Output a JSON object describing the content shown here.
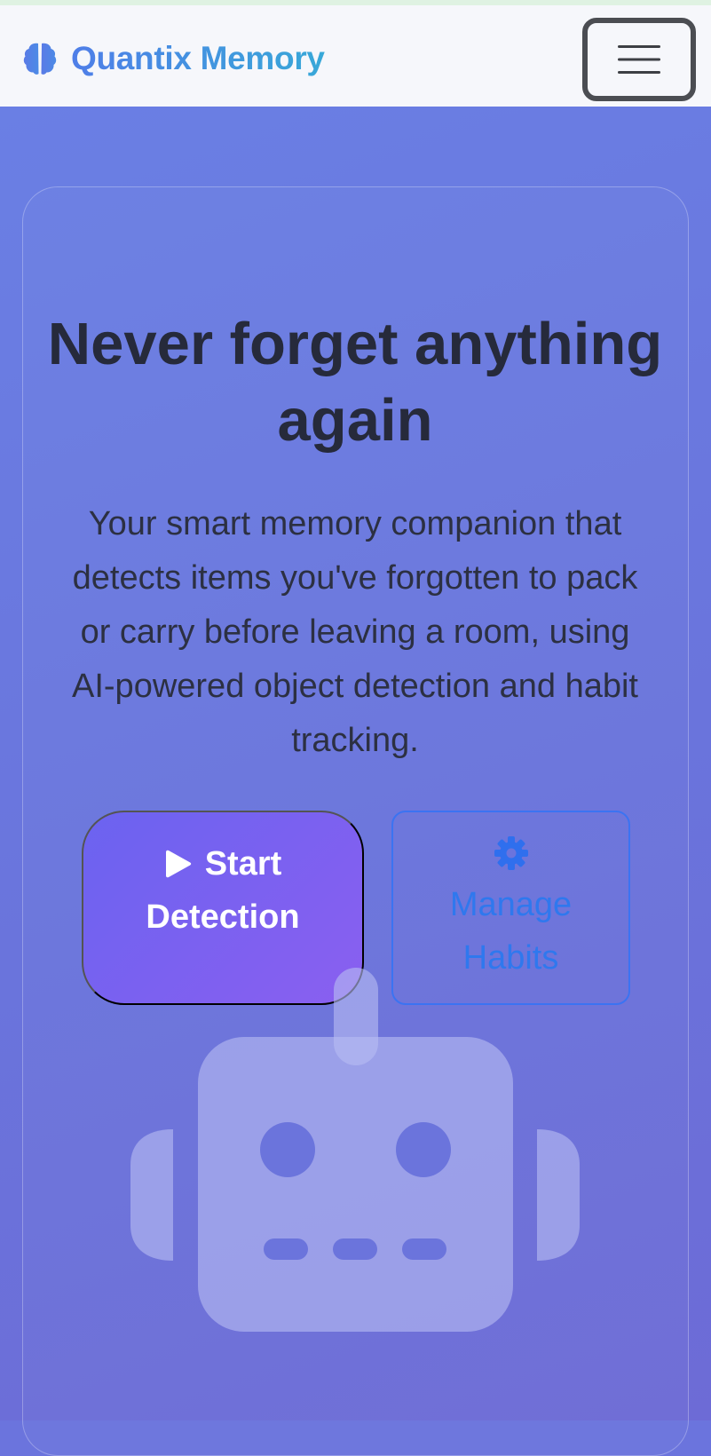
{
  "navbar": {
    "brand_name": "Quantix Memory",
    "brand_icon": "brain-icon",
    "menu_icon": "hamburger-icon",
    "brand_gradient": [
      "#4f7ee8",
      "#38a8d8"
    ]
  },
  "hero": {
    "headline": "Never forget anything again",
    "tagline": "Your smart memory companion that detects items you've forgotten to pack or carry before leaving a room, using AI-powered object detection and habit tracking.",
    "start_button": {
      "icon": "play-icon",
      "line1": "Start",
      "line2": "Detection"
    },
    "habits_button": {
      "icon": "gear-icon",
      "label": "Manage Habits"
    },
    "illustration_icon": "robot-icon"
  },
  "colors": {
    "hero_background": "#6a74dc",
    "primary_button": "#6b63f0",
    "outline_button": "#3b73f2",
    "headline_text": "#262a3b"
  }
}
